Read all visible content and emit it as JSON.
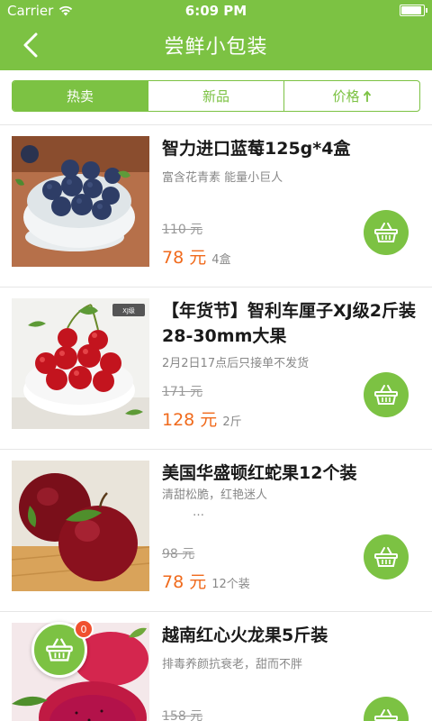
{
  "status_bar": {
    "carrier": "Carrier",
    "time": "6:09 PM",
    "battery_level": 0.95
  },
  "nav": {
    "title": "尝鲜小包装"
  },
  "tabs": [
    {
      "label": "热卖",
      "active": true
    },
    {
      "label": "新品",
      "active": false
    },
    {
      "label": "价格",
      "active": false,
      "icon": "arrow-up-icon"
    }
  ],
  "products": [
    {
      "name": "智力进口蓝莓125g*4盒",
      "desc": "富含花青素 能量小巨人",
      "old_price": "110 元",
      "price": "78 元",
      "unit": "4盒"
    },
    {
      "name": "【年货节】智利车厘子XJ级2斤装 28-30mm大果",
      "desc": "2月2日17点后只接单不发货",
      "old_price": "171 元",
      "price": "128 元",
      "unit": "2斤"
    },
    {
      "name": "美国华盛顿红蛇果12个装",
      "desc": "清甜松脆，红艳迷人",
      "desc_more": "…",
      "old_price": "98 元",
      "price": "78 元",
      "unit": "12个装"
    },
    {
      "name": "越南红心火龙果5斤装",
      "desc": "排毒养颜抗衰老，甜而不胖",
      "old_price": "158 元",
      "price": "",
      "unit": ""
    }
  ],
  "cart": {
    "count": "0"
  },
  "colors": {
    "brand": "#7cc243",
    "price": "#f06a1c",
    "badge": "#f0502f"
  }
}
